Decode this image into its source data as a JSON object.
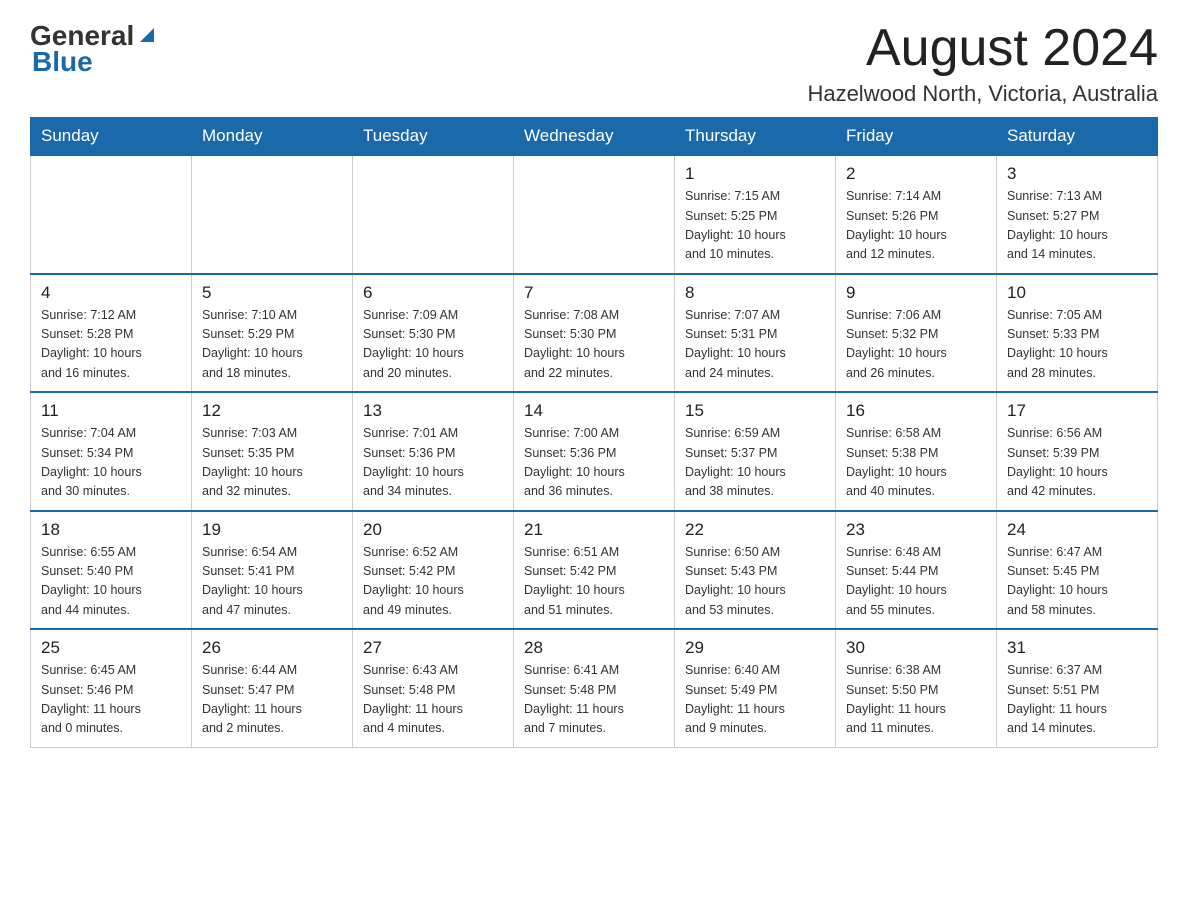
{
  "header": {
    "logo": {
      "general": "General",
      "blue": "Blue"
    },
    "month_title": "August 2024",
    "location": "Hazelwood North, Victoria, Australia"
  },
  "calendar": {
    "day_headers": [
      "Sunday",
      "Monday",
      "Tuesday",
      "Wednesday",
      "Thursday",
      "Friday",
      "Saturday"
    ],
    "weeks": [
      {
        "days": [
          {
            "number": "",
            "info": ""
          },
          {
            "number": "",
            "info": ""
          },
          {
            "number": "",
            "info": ""
          },
          {
            "number": "",
            "info": ""
          },
          {
            "number": "1",
            "info": "Sunrise: 7:15 AM\nSunset: 5:25 PM\nDaylight: 10 hours\nand 10 minutes."
          },
          {
            "number": "2",
            "info": "Sunrise: 7:14 AM\nSunset: 5:26 PM\nDaylight: 10 hours\nand 12 minutes."
          },
          {
            "number": "3",
            "info": "Sunrise: 7:13 AM\nSunset: 5:27 PM\nDaylight: 10 hours\nand 14 minutes."
          }
        ]
      },
      {
        "days": [
          {
            "number": "4",
            "info": "Sunrise: 7:12 AM\nSunset: 5:28 PM\nDaylight: 10 hours\nand 16 minutes."
          },
          {
            "number": "5",
            "info": "Sunrise: 7:10 AM\nSunset: 5:29 PM\nDaylight: 10 hours\nand 18 minutes."
          },
          {
            "number": "6",
            "info": "Sunrise: 7:09 AM\nSunset: 5:30 PM\nDaylight: 10 hours\nand 20 minutes."
          },
          {
            "number": "7",
            "info": "Sunrise: 7:08 AM\nSunset: 5:30 PM\nDaylight: 10 hours\nand 22 minutes."
          },
          {
            "number": "8",
            "info": "Sunrise: 7:07 AM\nSunset: 5:31 PM\nDaylight: 10 hours\nand 24 minutes."
          },
          {
            "number": "9",
            "info": "Sunrise: 7:06 AM\nSunset: 5:32 PM\nDaylight: 10 hours\nand 26 minutes."
          },
          {
            "number": "10",
            "info": "Sunrise: 7:05 AM\nSunset: 5:33 PM\nDaylight: 10 hours\nand 28 minutes."
          }
        ]
      },
      {
        "days": [
          {
            "number": "11",
            "info": "Sunrise: 7:04 AM\nSunset: 5:34 PM\nDaylight: 10 hours\nand 30 minutes."
          },
          {
            "number": "12",
            "info": "Sunrise: 7:03 AM\nSunset: 5:35 PM\nDaylight: 10 hours\nand 32 minutes."
          },
          {
            "number": "13",
            "info": "Sunrise: 7:01 AM\nSunset: 5:36 PM\nDaylight: 10 hours\nand 34 minutes."
          },
          {
            "number": "14",
            "info": "Sunrise: 7:00 AM\nSunset: 5:36 PM\nDaylight: 10 hours\nand 36 minutes."
          },
          {
            "number": "15",
            "info": "Sunrise: 6:59 AM\nSunset: 5:37 PM\nDaylight: 10 hours\nand 38 minutes."
          },
          {
            "number": "16",
            "info": "Sunrise: 6:58 AM\nSunset: 5:38 PM\nDaylight: 10 hours\nand 40 minutes."
          },
          {
            "number": "17",
            "info": "Sunrise: 6:56 AM\nSunset: 5:39 PM\nDaylight: 10 hours\nand 42 minutes."
          }
        ]
      },
      {
        "days": [
          {
            "number": "18",
            "info": "Sunrise: 6:55 AM\nSunset: 5:40 PM\nDaylight: 10 hours\nand 44 minutes."
          },
          {
            "number": "19",
            "info": "Sunrise: 6:54 AM\nSunset: 5:41 PM\nDaylight: 10 hours\nand 47 minutes."
          },
          {
            "number": "20",
            "info": "Sunrise: 6:52 AM\nSunset: 5:42 PM\nDaylight: 10 hours\nand 49 minutes."
          },
          {
            "number": "21",
            "info": "Sunrise: 6:51 AM\nSunset: 5:42 PM\nDaylight: 10 hours\nand 51 minutes."
          },
          {
            "number": "22",
            "info": "Sunrise: 6:50 AM\nSunset: 5:43 PM\nDaylight: 10 hours\nand 53 minutes."
          },
          {
            "number": "23",
            "info": "Sunrise: 6:48 AM\nSunset: 5:44 PM\nDaylight: 10 hours\nand 55 minutes."
          },
          {
            "number": "24",
            "info": "Sunrise: 6:47 AM\nSunset: 5:45 PM\nDaylight: 10 hours\nand 58 minutes."
          }
        ]
      },
      {
        "days": [
          {
            "number": "25",
            "info": "Sunrise: 6:45 AM\nSunset: 5:46 PM\nDaylight: 11 hours\nand 0 minutes."
          },
          {
            "number": "26",
            "info": "Sunrise: 6:44 AM\nSunset: 5:47 PM\nDaylight: 11 hours\nand 2 minutes."
          },
          {
            "number": "27",
            "info": "Sunrise: 6:43 AM\nSunset: 5:48 PM\nDaylight: 11 hours\nand 4 minutes."
          },
          {
            "number": "28",
            "info": "Sunrise: 6:41 AM\nSunset: 5:48 PM\nDaylight: 11 hours\nand 7 minutes."
          },
          {
            "number": "29",
            "info": "Sunrise: 6:40 AM\nSunset: 5:49 PM\nDaylight: 11 hours\nand 9 minutes."
          },
          {
            "number": "30",
            "info": "Sunrise: 6:38 AM\nSunset: 5:50 PM\nDaylight: 11 hours\nand 11 minutes."
          },
          {
            "number": "31",
            "info": "Sunrise: 6:37 AM\nSunset: 5:51 PM\nDaylight: 11 hours\nand 14 minutes."
          }
        ]
      }
    ]
  }
}
